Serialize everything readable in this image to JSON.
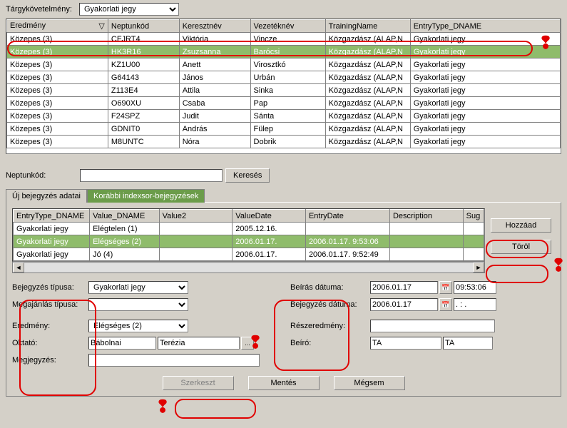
{
  "top": {
    "req_label": "Tárgykövetelmény:",
    "req_value": "Gyakorlati jegy"
  },
  "grid1": {
    "headers": [
      "Eredmény",
      "Neptunkód",
      "Keresztnév",
      "Vezetéknév",
      "TrainingName",
      "EntryType_DNAME"
    ],
    "rows": [
      [
        "Közepes (3)",
        "CFJRT4",
        "Viktória",
        "Vincze",
        "Közgazdász (ALAP,N",
        "Gyakorlati jegy"
      ],
      [
        "Közepes (3)",
        "HK3R16",
        "Zsuzsanna",
        "Barócsi",
        "Közgazdász (ALAP,N",
        "Gyakorlati jegy"
      ],
      [
        "Közepes (3)",
        "KZ1U00",
        "Anett",
        "Virosztkó",
        "Közgazdász (ALAP,N",
        "Gyakorlati jegy"
      ],
      [
        "Közepes (3)",
        "G64143",
        "János",
        "Urbán",
        "Közgazdász (ALAP,N",
        "Gyakorlati jegy"
      ],
      [
        "Közepes (3)",
        "Z113E4",
        "Attila",
        "Sinka",
        "Közgazdász (ALAP,N",
        "Gyakorlati jegy"
      ],
      [
        "Közepes (3)",
        "O690XU",
        "Csaba",
        "Pap",
        "Közgazdász (ALAP,N",
        "Gyakorlati jegy"
      ],
      [
        "Közepes (3)",
        "F24SPZ",
        "Judit",
        "Sánta",
        "Közgazdász (ALAP,N",
        "Gyakorlati jegy"
      ],
      [
        "Közepes (3)",
        "GDNIT0",
        "András",
        "Fülep",
        "Közgazdász (ALAP,N",
        "Gyakorlati jegy"
      ],
      [
        "Közepes (3)",
        "M8UNTC",
        "Nóra",
        "Dobrik",
        "Közgazdász (ALAP,N",
        "Gyakorlati jegy"
      ]
    ],
    "selected": 1
  },
  "search": {
    "label": "Neptunkód:",
    "value": "",
    "button": "Keresés"
  },
  "tabs": {
    "tab1": "Új bejegyzés adatai",
    "tab2": "Korábbi indexsor-bejegyzések"
  },
  "grid2": {
    "headers": [
      "EntryType_DNAME",
      "Value_DNAME",
      "Value2",
      "ValueDate",
      "EntryDate",
      "Description",
      "Sug"
    ],
    "rows": [
      [
        "Gyakorlati jegy",
        "Elégtelen (1)",
        "",
        "2005.12.16.",
        "",
        "",
        ""
      ],
      [
        "Gyakorlati jegy",
        "Elégséges (2)",
        "",
        "2006.01.17.",
        "2006.01.17. 9:53:06",
        "",
        ""
      ],
      [
        "Gyakorlati jegy",
        "Jó (4)",
        "",
        "2006.01.17.",
        "2006.01.17. 9:52:49",
        "",
        ""
      ]
    ],
    "selected": 1
  },
  "side_buttons": {
    "add": "Hozzáad",
    "del": "Töröl"
  },
  "form": {
    "type_label": "Bejegyzés típusa:",
    "type_value": "Gyakorlati jegy",
    "offer_label": "Megajánlás típusa:",
    "offer_value": "",
    "result_label": "Eredmény:",
    "result_value": "Elégséges (2)",
    "teacher_label": "Oktató:",
    "teacher_last": "Bábolnai",
    "teacher_first": "Terézia",
    "note_label": "Megjegyzés:",
    "note_value": "",
    "writedate_label": "Beírás dátuma:",
    "writedate_value": "2006.01.17",
    "writetime_value": "09:53:06",
    "entrydate_label": "Bejegyzés dátuma:",
    "entrydate_value": "2006.01.17",
    "entrytime_value": ". : .",
    "partial_label": "Részeredmény:",
    "partial_value": "",
    "writer_label": "Beíró:",
    "writer1": "TA",
    "writer2": "TA"
  },
  "bottom_buttons": {
    "edit": "Szerkeszt",
    "save": "Mentés",
    "cancel": "Mégsem"
  }
}
